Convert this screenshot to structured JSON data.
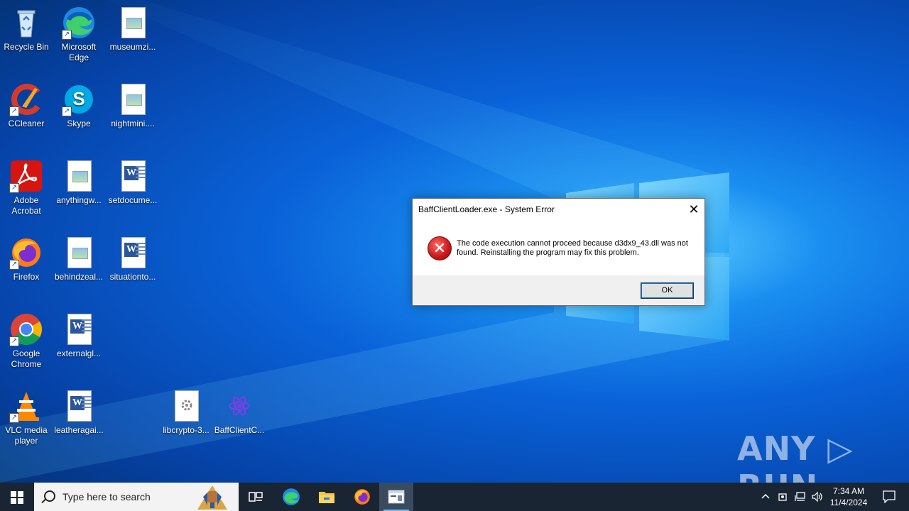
{
  "desktop": {
    "icons": [
      {
        "label": "Recycle Bin"
      },
      {
        "label": "Microsoft Edge"
      },
      {
        "label": "museumzi..."
      },
      {
        "label": "CCleaner"
      },
      {
        "label": "Skype"
      },
      {
        "label": "nightmini...."
      },
      {
        "label": "Adobe Acrobat"
      },
      {
        "label": "anythingw..."
      },
      {
        "label": "setdocume..."
      },
      {
        "label": "Firefox"
      },
      {
        "label": "behindzeal..."
      },
      {
        "label": "situationto..."
      },
      {
        "label": "Google Chrome"
      },
      {
        "label": "externalgl..."
      },
      {
        "label": "VLC media player"
      },
      {
        "label": "leatheragai..."
      },
      {
        "label": "libcrypto-3..."
      },
      {
        "label": "BaffClientC..."
      }
    ]
  },
  "dialog": {
    "title": "BaffClientLoader.exe - System Error",
    "message": "The code execution cannot proceed because d3dx9_43.dll was not found. Reinstalling the program may fix this problem.",
    "ok_label": "OK",
    "close_symbol": "✕"
  },
  "watermark": {
    "text": "ANY ▷ RUN"
  },
  "taskbar": {
    "search_placeholder": "Type here to search",
    "time": "7:34 AM",
    "date": "11/4/2024"
  },
  "colors": {
    "accent": "#0078d7",
    "taskbar": "#1a2533",
    "error_red": "#c81717"
  }
}
